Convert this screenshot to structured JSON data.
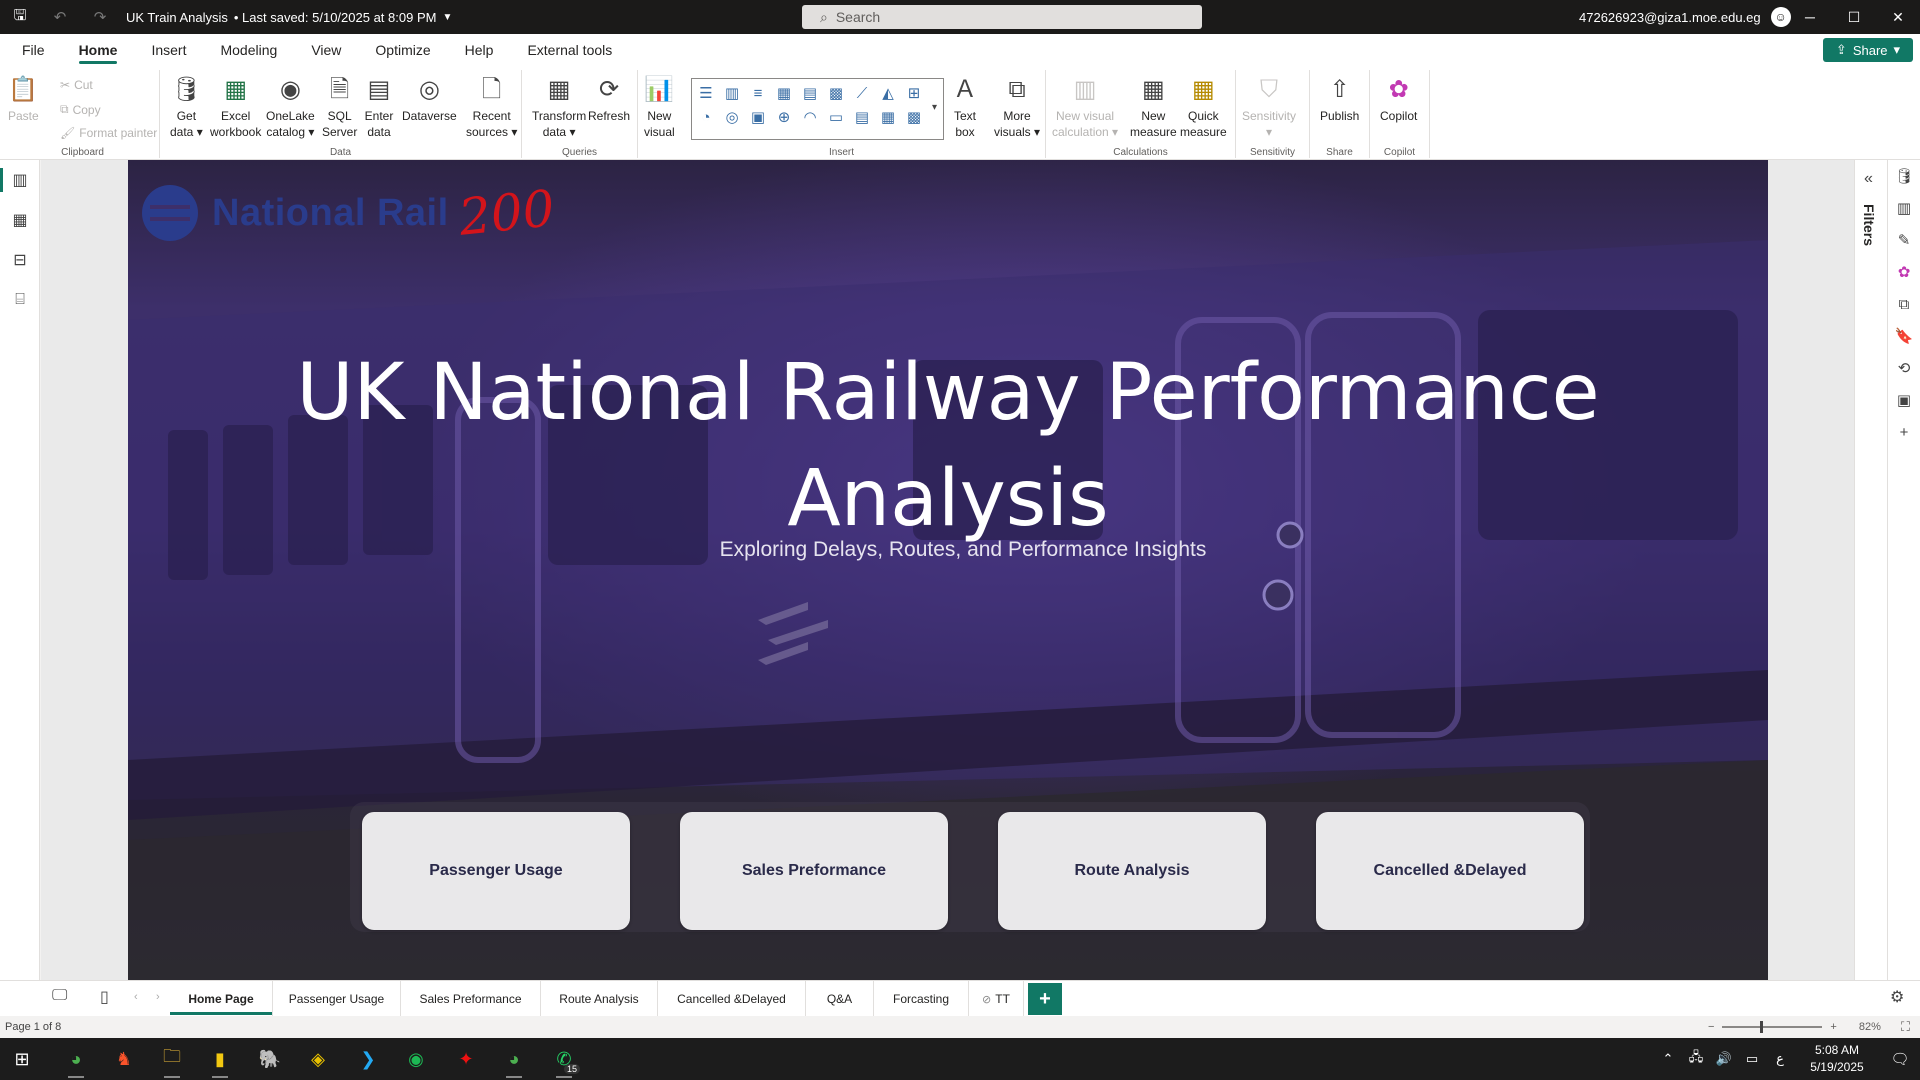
{
  "titlebar": {
    "doc_title": "UK Train Analysis",
    "saved_status": "• Last saved: 5/10/2025 at 8:09 PM",
    "search_placeholder": "Search",
    "user_email": "472626923@giza1.moe.edu.eg"
  },
  "menu": {
    "tabs": [
      "File",
      "Home",
      "Insert",
      "Modeling",
      "View",
      "Optimize",
      "Help",
      "External tools"
    ],
    "active": "Home",
    "share_label": "Share"
  },
  "ribbon": {
    "clipboard": {
      "paste": "Paste",
      "cut": "Cut",
      "copy": "Copy",
      "format_painter": "Format painter",
      "group": "Clipboard"
    },
    "data": {
      "group": "Data",
      "buttons": [
        {
          "l1": "Get",
          "l2": "data"
        },
        {
          "l1": "Excel",
          "l2": "workbook"
        },
        {
          "l1": "OneLake",
          "l2": "catalog"
        },
        {
          "l1": "SQL",
          "l2": "Server"
        },
        {
          "l1": "Enter",
          "l2": "data"
        },
        {
          "l1": "Dataverse",
          "l2": ""
        },
        {
          "l1": "Recent",
          "l2": "sources"
        }
      ]
    },
    "queries": {
      "group": "Queries",
      "transform_l1": "Transform",
      "transform_l2": "data",
      "refresh": "Refresh"
    },
    "insert": {
      "group": "Insert",
      "new_visual_l1": "New",
      "new_visual_l2": "visual",
      "text_box_l1": "Text",
      "text_box_l2": "box",
      "more_visuals_l1": "More",
      "more_visuals_l2": "visuals"
    },
    "calculations": {
      "group": "Calculations",
      "new_visual_calc_l1": "New visual",
      "new_visual_calc_l2": "calculation",
      "new_measure_l1": "New",
      "new_measure_l2": "measure",
      "quick_measure_l1": "Quick",
      "quick_measure_l2": "measure"
    },
    "sensitivity": {
      "group": "Sensitivity",
      "label": "Sensitivity"
    },
    "share": {
      "group": "Share",
      "publish": "Publish"
    },
    "copilot": {
      "group": "Copilot",
      "label": "Copilot"
    }
  },
  "report": {
    "logo_text": "National Rail",
    "logo_number": "200",
    "headline_line1": "UK National Railway Performance",
    "headline_line2": "Analysis",
    "subtitle": "Exploring Delays, Routes, and Performance Insights",
    "nav_buttons": [
      "Passenger Usage",
      "Sales Preformance",
      "Route Analysis",
      "Cancelled &Delayed"
    ]
  },
  "filters_label": "Filters",
  "pages": {
    "tabs": [
      "Home Page",
      "Passenger Usage",
      "Sales Preformance",
      "Route Analysis",
      "Cancelled &Delayed",
      "Q&A",
      "Forcasting",
      "TT"
    ],
    "active": "Home Page"
  },
  "status": {
    "page_indicator": "Page 1 of 8",
    "zoom_minus": "−",
    "zoom_plus": "+",
    "zoom_level": "82%",
    "zoom_fraction": 0.38
  },
  "taskbar": {
    "whatsapp_badge": "15",
    "lang": "ع",
    "time": "5:08 AM",
    "date": "5/19/2025"
  },
  "colors": {
    "accent": "#117865",
    "titlebar": "#1b1a19",
    "headline": "#ffffff",
    "nav_card": "#e9e8ea",
    "logo_blue": "#2a3c8c",
    "logo_red": "#d3141b"
  }
}
